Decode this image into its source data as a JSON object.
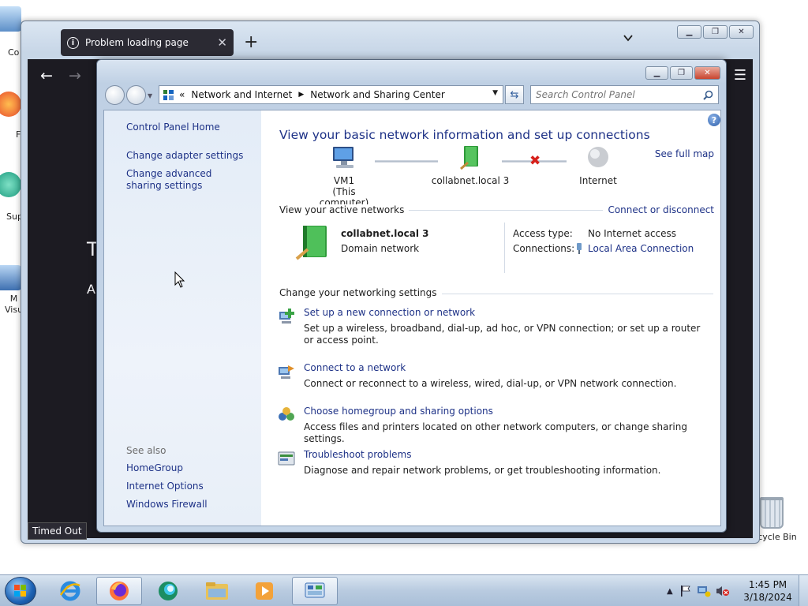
{
  "desktop": {
    "icons": [
      {
        "label": "Co"
      },
      {
        "label": "F"
      },
      {
        "label": "Sup"
      },
      {
        "label": "M\nVisu"
      }
    ],
    "recycle_bin": "Recycle Bin"
  },
  "firefox": {
    "tab_title": "Problem loading page",
    "tab_close": "✕",
    "new_tab": "+",
    "content_text_1": "T",
    "content_text_2": "A",
    "status": "Timed Out"
  },
  "control_panel": {
    "breadcrumb": {
      "overflow": "«",
      "items": [
        "Network and Internet",
        "Network and Sharing Center"
      ]
    },
    "search_placeholder": "Search Control Panel",
    "left_nav": {
      "items": [
        "Control Panel Home",
        "Change adapter settings",
        "Change advanced sharing settings"
      ],
      "see_also_label": "See also",
      "see_also": [
        "HomeGroup",
        "Internet Options",
        "Windows Firewall"
      ]
    },
    "main": {
      "title": "View your basic network information and set up connections",
      "see_full_map": "See full map",
      "map": {
        "computer_name": "VM1",
        "computer_sub": "(This computer)",
        "network": "collabnet.local  3",
        "internet": "Internet"
      },
      "active_networks": {
        "label": "View your active networks",
        "connect_link": "Connect or disconnect",
        "network_name": "collabnet.local  3",
        "network_type": "Domain network",
        "access_type_label": "Access type:",
        "access_type_value": "No Internet access",
        "connections_label": "Connections:",
        "connections_value": "Local Area Connection"
      },
      "settings": {
        "label": "Change your networking settings",
        "tasks": [
          {
            "link": "Set up a new connection or network",
            "desc": "Set up a wireless, broadband, dial-up, ad hoc, or VPN connection; or set up a router or access point."
          },
          {
            "link": "Connect to a network",
            "desc": "Connect or reconnect to a wireless, wired, dial-up, or VPN network connection."
          },
          {
            "link": "Choose homegroup and sharing options",
            "desc": "Access files and printers located on other network computers, or change sharing settings."
          },
          {
            "link": "Troubleshoot problems",
            "desc": "Diagnose and repair network problems, or get troubleshooting information."
          }
        ]
      }
    }
  },
  "taskbar": {
    "pinned": [
      "internet-explorer",
      "firefox",
      "edge",
      "file-explorer",
      "media-player",
      "control-panel"
    ],
    "clock_time": "1:45 PM",
    "clock_date": "3/18/2024"
  }
}
